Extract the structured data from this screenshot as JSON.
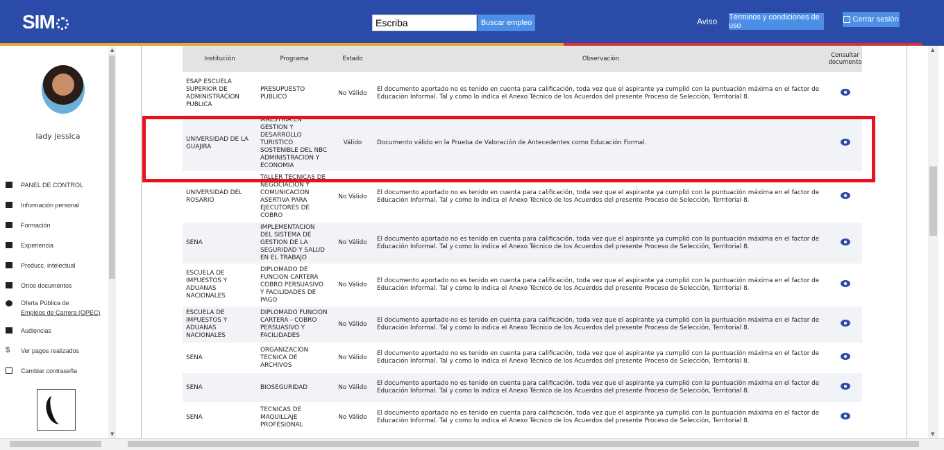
{
  "header": {
    "logo": "SIM",
    "search_placeholder": "Escriba",
    "search_button": "Buscar empleo",
    "aviso": "Aviso",
    "terms_button": "Términos y condiciones de uso",
    "logout_button": "Cerrar sesión",
    "colors": {
      "bar": "#2a4ba8",
      "button": "#4d8fe6",
      "stripe_yellow": "#e8a823",
      "stripe_red": "#d9323b"
    }
  },
  "sidebar": {
    "username": "lady jessica",
    "items": [
      {
        "label": "PANEL DE CONTROL",
        "icon": "grid-icon"
      },
      {
        "label": "Información personal",
        "icon": "people-icon"
      },
      {
        "label": "Formación",
        "icon": "graduation-icon"
      },
      {
        "label": "Experiencia",
        "icon": "briefcase-icon"
      },
      {
        "label": "Producc. intelectual",
        "icon": "book-icon"
      },
      {
        "label": "Otros documentos",
        "icon": "document-icon"
      },
      {
        "label": "Oferta Pública de",
        "label2": "Empleos de Carrera (OPEC)",
        "icon": "globe-icon"
      },
      {
        "label": "Audiencias",
        "icon": "speaker-icon"
      },
      {
        "label": "Ver pagos realizados",
        "icon": "dollar-icon"
      },
      {
        "label": "Cambiar contraseña",
        "icon": "lock-icon"
      }
    ]
  },
  "table": {
    "headers": [
      "Institución",
      "Programa",
      "Estado",
      "Observación",
      "Consultar documento"
    ],
    "rows": [
      {
        "institucion": "ESAP ESCUELA SUPERIOR DE ADMINISTRACION PUBLICA",
        "programa": "PRESUPUESTO PUBLICO",
        "estado": "No Válido",
        "observacion": "El documento aportado no es tenido en cuenta para calificación, toda vez que el aspirante ya cumplió con la puntuación máxima en el factor de Educación Informal. Tal y como lo indica el Anexo Técnico de los Acuerdos del presente Proceso de Selección, Territorial 8."
      },
      {
        "institucion": "UNIVERSIDAD DE LA GUAJIRA",
        "programa": "MAESTRIA EN GESTION Y DESARROLLO TURISTICO SOSTENIBLE DEL NBC ADMINISTRACION Y ECONOMIA",
        "estado": "Válido",
        "observacion": "Documento válido en la Prueba de Valoración de Antecedentes como Educación Formal."
      },
      {
        "institucion": "UNIVERSIDAD DEL ROSARIO",
        "programa": "TALLER TECNICAS DE NEGOCIACION Y COMUNICACION ASERTIVA PARA EJECUTORES DE COBRO",
        "estado": "No Válido",
        "observacion": "El documento aportado no es tenido en cuenta para calificación, toda vez que el aspirante ya cumplió con la puntuación máxima en el factor de Educación Informal. Tal y como lo indica el Anexo Técnico de los Acuerdos del presente Proceso de Selección, Territorial 8."
      },
      {
        "institucion": "SENA",
        "programa": "IMPLEMENTACION DEL SISTEMA DE GESTION DE LA SEGURIDAD Y SALUD EN EL TRABAJO",
        "estado": "No Válido",
        "observacion": "El documento aportado no es tenido en cuenta para calificación, toda vez que el aspirante ya cumplió con la puntuación máxima en el factor de Educación Informal. Tal y como lo indica el Anexo Técnico de los Acuerdos del presente Proceso de Selección, Territorial 8."
      },
      {
        "institucion": "ESCUELA DE IMPUESTOS Y ADUANAS NACIONALES",
        "programa": "DIPLOMADO DE FUNCION CARTERA COBRO PERSUASIVO Y FACILIDADES DE PAGO",
        "estado": "No Válido",
        "observacion": "El documento aportado no es tenido en cuenta para calificación, toda vez que el aspirante ya cumplió con la puntuación máxima en el factor de Educación Informal. Tal y como lo indica el Anexo Técnico de los Acuerdos del presente Proceso de Selección, Territorial 8."
      },
      {
        "institucion": "ESCUELA DE IMPUESTOS Y ADUANAS NACIONALES",
        "programa": "DIPLOMADO FUNCION CARTERA - COBRO PERSUASIVO Y FACILIDADES",
        "estado": "No Válido",
        "observacion": "El documento aportado no es tenido en cuenta para calificación, toda vez que el aspirante ya cumplió con la puntuación máxima en el factor de Educación Informal. Tal y como lo indica el Anexo Técnico de los Acuerdos del presente Proceso de Selección, Territorial 8."
      },
      {
        "institucion": "SENA",
        "programa": "ORGANIZACION TECNICA DE ARCHIVOS",
        "estado": "No Válido",
        "observacion": "El documento aportado no es tenido en cuenta para calificación, toda vez que el aspirante ya cumplió con la puntuación máxima en el factor de Educación Informal. Tal y como lo indica el Anexo Técnico de los Acuerdos del presente Proceso de Selección, Territorial 8."
      },
      {
        "institucion": "SENA",
        "programa": "BIOSEGURIDAD",
        "estado": "No Válido",
        "observacion": "El documento aportado no es tenido en cuenta para calificación, toda vez que el aspirante ya cumplió con la puntuación máxima en el factor de Educación Informal. Tal y como lo indica el Anexo Técnico de los Acuerdos del presente Proceso de Selección, Territorial 8."
      },
      {
        "institucion": "SENA",
        "programa": "TECNICAS DE MAQUILLAJE PROFESIONAL",
        "estado": "No Válido",
        "observacion": "El documento aportado no es tenido en cuenta para calificación, toda vez que el aspirante ya cumplió con la puntuación máxima en el factor de Educación Informal. Tal y como lo indica el Anexo Técnico de los Acuerdos del presente Proceso de Selección, Territorial 8."
      }
    ]
  },
  "highlight_color": "#e8121e"
}
